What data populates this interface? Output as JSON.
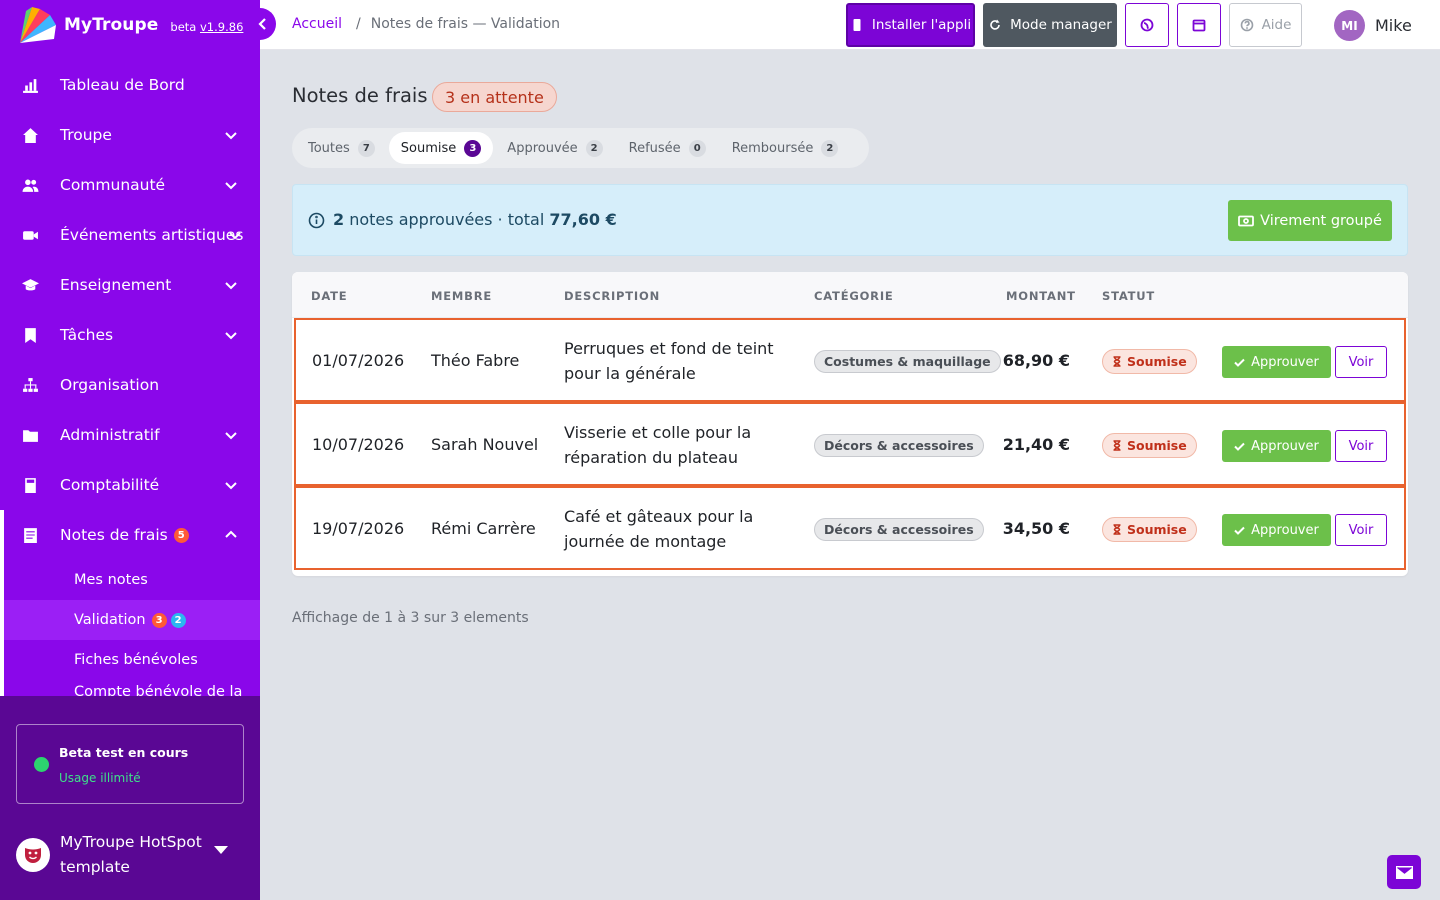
{
  "brand": {
    "name": "MyTroupe",
    "beta_prefix": "beta ",
    "version": "v1.9.86"
  },
  "sidebar": {
    "items": [
      {
        "label": "Tableau de Bord",
        "icon": "chart-bar-icon",
        "has_chevron": false
      },
      {
        "label": "Troupe",
        "icon": "home-icon",
        "has_chevron": true
      },
      {
        "label": "Communauté",
        "icon": "users-icon",
        "has_chevron": true
      },
      {
        "label": "Événements artistiques",
        "icon": "video-icon",
        "has_chevron": true
      },
      {
        "label": "Enseignement",
        "icon": "graduation-cap-icon",
        "has_chevron": true
      },
      {
        "label": "Tâches",
        "icon": "bookmark-icon",
        "has_chevron": true
      },
      {
        "label": "Organisation",
        "icon": "org-chart-icon",
        "has_chevron": false
      },
      {
        "label": "Administratif",
        "icon": "folder-icon",
        "has_chevron": true
      },
      {
        "label": "Comptabilité",
        "icon": "calculator-icon",
        "has_chevron": true
      },
      {
        "label": "Notes de frais",
        "icon": "receipt-icon",
        "has_chevron": true,
        "badge": "5",
        "expanded": true
      }
    ],
    "sub_items": [
      {
        "label": "Mes notes"
      },
      {
        "label": "Validation",
        "badge_orange": "3",
        "badge_blue": "2",
        "current": true
      },
      {
        "label": "Fiches bénévoles"
      },
      {
        "label": "Compte bénévole de la troupe"
      }
    ],
    "beta": {
      "title": "Beta test en cours",
      "subtitle": "Usage illimité"
    },
    "org": {
      "name": "MyTroupe HotSpot template"
    }
  },
  "topbar": {
    "breadcrumb": {
      "home": "Accueil",
      "current": "Notes de frais — Validation"
    },
    "install_label": "Installer l'appli",
    "manager_label": "Mode manager",
    "help_label": "Aide",
    "user": {
      "initials": "MI",
      "name": "Mike"
    }
  },
  "page": {
    "title": "Notes de frais",
    "pending": "3 en attente",
    "tabs": [
      {
        "label": "Toutes",
        "count": "7"
      },
      {
        "label": "Soumise",
        "count": "3",
        "active": true
      },
      {
        "label": "Approuvée",
        "count": "2"
      },
      {
        "label": "Refusée",
        "count": "0"
      },
      {
        "label": "Remboursée",
        "count": "2"
      }
    ],
    "info": {
      "count": "2",
      "text_mid": " notes approuvées · total ",
      "total": "77,60 €"
    },
    "virement_label": "Virement groupé",
    "table": {
      "headers": {
        "date": "DATE",
        "member": "MEMBRE",
        "description": "DESCRIPTION",
        "category": "CATÉGORIE",
        "amount": "MONTANT",
        "status": "STATUT"
      },
      "rows": [
        {
          "date": "01/07/2026",
          "member": "Théo Fabre",
          "desc1": "Perruques et fond de teint",
          "desc2": "pour la générale",
          "category": "Costumes & maquillage",
          "amount": "68,90 €",
          "status": "Soumise"
        },
        {
          "date": "10/07/2026",
          "member": "Sarah Nouvel",
          "desc1": "Visserie et colle pour la",
          "desc2": "réparation du plateau",
          "category": "Décors & accessoires",
          "amount": "21,40 €",
          "status": "Soumise"
        },
        {
          "date": "19/07/2026",
          "member": "Rémi Carrère",
          "desc1": "Café et gâteaux pour la",
          "desc2": "journée de montage",
          "category": "Décors & accessoires",
          "amount": "34,50 €",
          "status": "Soumise"
        }
      ],
      "approve_label": "Approuver",
      "view_label": "Voir"
    },
    "footer": "Affichage de 1 à 3 sur 3 elements"
  },
  "colors": {
    "brand_purple": "#8a07ea",
    "success_green": "#6cc04a",
    "alert_orange": "#e8622e",
    "info_blue": "#d6eefa"
  }
}
